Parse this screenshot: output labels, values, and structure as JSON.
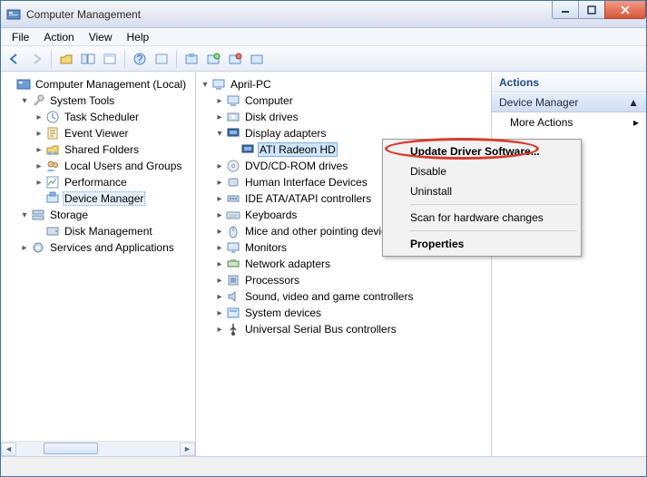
{
  "window": {
    "title": "Computer Management"
  },
  "menubar": [
    "File",
    "Action",
    "View",
    "Help"
  ],
  "left_tree": [
    {
      "ind": 0,
      "exp": "",
      "icon": "mmc",
      "label": "Computer Management (Local)"
    },
    {
      "ind": 1,
      "exp": "▾",
      "icon": "tools",
      "label": "System Tools"
    },
    {
      "ind": 2,
      "exp": "▸",
      "icon": "sched",
      "label": "Task Scheduler"
    },
    {
      "ind": 2,
      "exp": "▸",
      "icon": "event",
      "label": "Event Viewer"
    },
    {
      "ind": 2,
      "exp": "▸",
      "icon": "shared",
      "label": "Shared Folders"
    },
    {
      "ind": 2,
      "exp": "▸",
      "icon": "users",
      "label": "Local Users and Groups"
    },
    {
      "ind": 2,
      "exp": "▸",
      "icon": "perf",
      "label": "Performance"
    },
    {
      "ind": 2,
      "exp": "",
      "icon": "devmgr",
      "label": "Device Manager",
      "sel": true
    },
    {
      "ind": 1,
      "exp": "▾",
      "icon": "storage",
      "label": "Storage"
    },
    {
      "ind": 2,
      "exp": "",
      "icon": "disk",
      "label": "Disk Management"
    },
    {
      "ind": 1,
      "exp": "▸",
      "icon": "services",
      "label": "Services and Applications"
    }
  ],
  "mid_tree": [
    {
      "ind": 0,
      "exp": "▾",
      "icon": "pc",
      "label": "April-PC"
    },
    {
      "ind": 1,
      "exp": "▸",
      "icon": "pc",
      "label": "Computer"
    },
    {
      "ind": 1,
      "exp": "▸",
      "icon": "diskdrv",
      "label": "Disk drives"
    },
    {
      "ind": 1,
      "exp": "▾",
      "icon": "display",
      "label": "Display adapters"
    },
    {
      "ind": 2,
      "exp": "",
      "icon": "display",
      "label": "ATI Radeon HD",
      "sel": true
    },
    {
      "ind": 1,
      "exp": "▸",
      "icon": "dvd",
      "label": "DVD/CD-ROM drives"
    },
    {
      "ind": 1,
      "exp": "▸",
      "icon": "hid",
      "label": "Human Interface Devices"
    },
    {
      "ind": 1,
      "exp": "▸",
      "icon": "ide",
      "label": "IDE ATA/ATAPI controllers"
    },
    {
      "ind": 1,
      "exp": "▸",
      "icon": "kb",
      "label": "Keyboards"
    },
    {
      "ind": 1,
      "exp": "▸",
      "icon": "mouse",
      "label": "Mice and other pointing devices"
    },
    {
      "ind": 1,
      "exp": "▸",
      "icon": "monitor",
      "label": "Monitors"
    },
    {
      "ind": 1,
      "exp": "▸",
      "icon": "net",
      "label": "Network adapters"
    },
    {
      "ind": 1,
      "exp": "▸",
      "icon": "cpu",
      "label": "Processors"
    },
    {
      "ind": 1,
      "exp": "▸",
      "icon": "sound",
      "label": "Sound, video and game controllers"
    },
    {
      "ind": 1,
      "exp": "▸",
      "icon": "sys",
      "label": "System devices"
    },
    {
      "ind": 1,
      "exp": "▸",
      "icon": "usb",
      "label": "Universal Serial Bus controllers"
    }
  ],
  "actions": {
    "header": "Actions",
    "section": "Device Manager",
    "item": "More Actions"
  },
  "context_menu": [
    {
      "label": "Update Driver Software...",
      "bold": true
    },
    {
      "label": "Disable"
    },
    {
      "label": "Uninstall"
    },
    {
      "sep": true
    },
    {
      "label": "Scan for hardware changes"
    },
    {
      "sep": true
    },
    {
      "label": "Properties",
      "bold": true
    }
  ]
}
